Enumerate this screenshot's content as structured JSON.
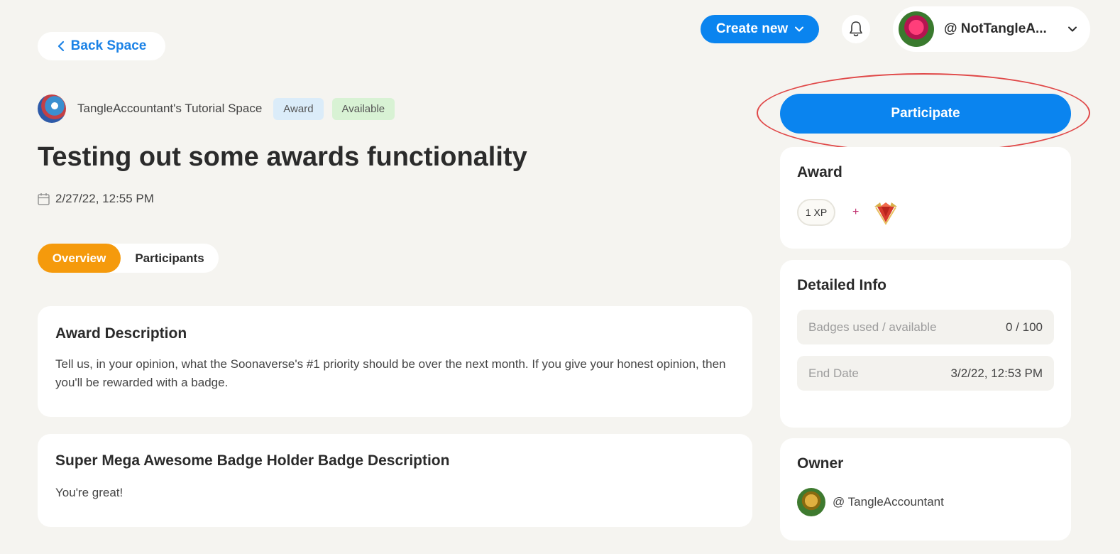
{
  "header": {
    "back_label": "Back Space",
    "create_label": "Create new",
    "user_name": "@ NotTangleA..."
  },
  "space": {
    "name": "TangleAccountant's Tutorial Space",
    "tags": [
      "Award",
      "Available"
    ]
  },
  "award": {
    "title": "Testing out some awards functionality",
    "date": "2/27/22, 12:55 PM"
  },
  "tabs": [
    "Overview",
    "Participants"
  ],
  "description_card": {
    "heading": "Award Description",
    "text": "Tell us, in your opinion, what the Soonaverse's #1 priority should be over the next month. If you give your honest opinion, then you'll be rewarded with a badge."
  },
  "badge_card": {
    "heading": "Super Mega Awesome Badge Holder Badge Description",
    "text": "You're great!"
  },
  "sidebar": {
    "participate_label": "Participate",
    "award_heading": "Award",
    "xp_label": "1 XP",
    "plus": "+",
    "detailed_heading": "Detailed Info",
    "info_rows": [
      {
        "label": "Badges used / available",
        "value": "0 / 100"
      },
      {
        "label": "End Date",
        "value": "3/2/22, 12:53 PM"
      }
    ],
    "owner_heading": "Owner",
    "owner_name": "@ TangleAccountant"
  },
  "colors": {
    "primary_blue": "#0a84ef",
    "tab_active": "#f59a0c",
    "highlight": "#e04848",
    "background": "#f5f4f0"
  }
}
